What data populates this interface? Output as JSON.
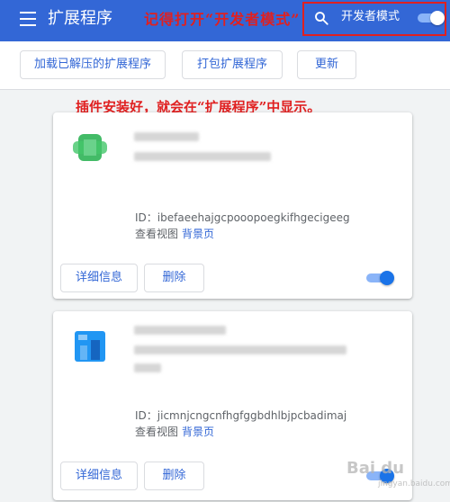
{
  "header": {
    "title": "扩展程序",
    "menu_icon": "hamburger-menu-icon",
    "search_icon": "search-icon",
    "developer_mode_label": "开发者模式",
    "developer_mode_on": true,
    "background_color": "#3367d6"
  },
  "annotations": {
    "top": "记得打开“开发者模式”",
    "middle": "插件安装好，就会在“扩展程序”中显示。",
    "color": "#e02020"
  },
  "toolbar": {
    "load_unpacked_label": "加载已解压的扩展程序",
    "pack_label": "打包扩展程序",
    "update_label": "更新"
  },
  "extensions": [
    {
      "id_text": "ID：ibefaeehajgcpooopoegkifhgecigeeg",
      "views_label": "查看视图",
      "views_link": "背景页",
      "details_label": "详细信息",
      "remove_label": "删除",
      "enabled": true,
      "icon_color": "#2fb457"
    },
    {
      "id_text": "ID：jicmnjcngcnfhgfggbdhlbjpcbadimaj",
      "views_label": "查看视图",
      "views_link": "背景页",
      "details_label": "详细信息",
      "remove_label": "删除",
      "enabled": true,
      "icon_color": "#2196f3"
    }
  ],
  "watermark": {
    "text": "Bai du",
    "sub": "jingyan.baidu.com"
  }
}
